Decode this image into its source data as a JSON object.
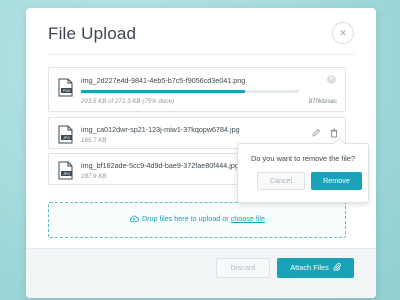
{
  "modal": {
    "title": "File Upload",
    "close_icon": "close-icon"
  },
  "files": [
    {
      "name": "img_2d227e4d-9841-4eb5-b7c5-f9056cd3e041.png",
      "ext": "PNG",
      "meta": "203.5 KB of 271.3 KB (75% done)",
      "progress": 0.75,
      "speed": "870kb/sec",
      "uploading": true
    },
    {
      "name": "img_ca012dwr-sp21-123j-miw1-37kqopw6784.jpg",
      "ext": "JPG",
      "meta": "165.7 KB"
    },
    {
      "name": "img_bf182ade-5cc9-4d9d-bae9-372fae80f444.jpg",
      "ext": "JPG",
      "meta": "187.9 KB"
    }
  ],
  "dropzone": {
    "text": "Drop files here to upload or",
    "link": "choose file",
    "icon": "cloud-upload-icon"
  },
  "popover": {
    "question": "Do you want to remove the file?",
    "cancel_label": "Cancel",
    "remove_label": "Remove"
  },
  "footer": {
    "discard_label": "Discard",
    "attach_label": "Attach Files",
    "attach_icon": "paperclip-icon"
  },
  "colors": {
    "accent": "#1aa3b8",
    "background": "#9fd8da",
    "file_icon": "#3a4954"
  }
}
